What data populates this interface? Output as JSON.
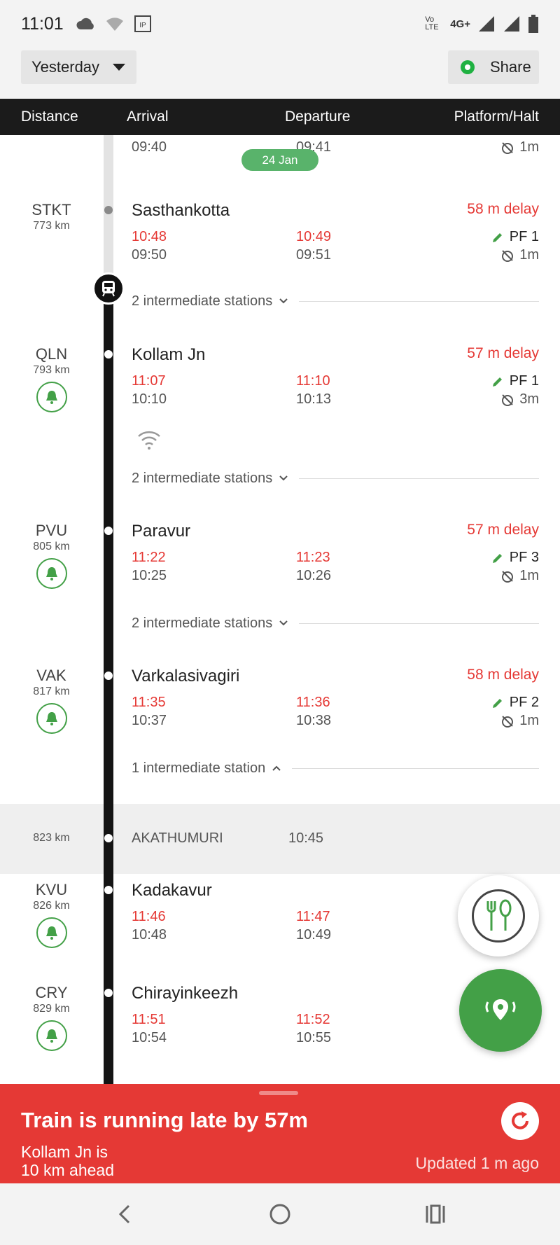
{
  "status_bar": {
    "time": "11:01",
    "network": "4G+",
    "volte": "Vo LTE"
  },
  "top": {
    "day_selector": "Yesterday",
    "share_label": "Share"
  },
  "columns": [
    "Distance",
    "Arrival",
    "Departure",
    "Platform/Halt"
  ],
  "date_pill": "24 Jan",
  "partial_row": {
    "arr_sched": "09:40",
    "dep_sched": "09:41",
    "halt": "1m"
  },
  "stations": [
    {
      "code": "STKT",
      "km": "773 km",
      "name": "Sasthankotta",
      "delay": "58 m delay",
      "arr_actual": "10:48",
      "arr_sched": "09:50",
      "dep_actual": "10:49",
      "dep_sched": "09:51",
      "pf": "PF 1",
      "halt": "1m",
      "alert": false
    },
    {
      "code": "QLN",
      "km": "793 km",
      "name": "Kollam Jn",
      "delay": "57 m delay",
      "arr_actual": "11:07",
      "arr_sched": "10:10",
      "dep_actual": "11:10",
      "dep_sched": "10:13",
      "pf": "PF 1",
      "halt": "3m",
      "alert": true
    },
    {
      "code": "PVU",
      "km": "805 km",
      "name": "Paravur",
      "delay": "57 m delay",
      "arr_actual": "11:22",
      "arr_sched": "10:25",
      "dep_actual": "11:23",
      "dep_sched": "10:26",
      "pf": "PF 3",
      "halt": "1m",
      "alert": true
    },
    {
      "code": "VAK",
      "km": "817 km",
      "name": "Varkalasivagiri",
      "delay": "58 m delay",
      "arr_actual": "11:35",
      "arr_sched": "10:37",
      "dep_actual": "11:36",
      "dep_sched": "10:38",
      "pf": "PF 2",
      "halt": "1m",
      "alert": true
    },
    {
      "code": "KVU",
      "km": "826 km",
      "name": "Kadakavur",
      "arr_actual": "11:46",
      "arr_sched": "10:48",
      "dep_actual": "11:47",
      "dep_sched": "10:49",
      "alert": true
    },
    {
      "code": "CRY",
      "km": "829 km",
      "name": "Chirayinkeezh",
      "arr_actual": "11:51",
      "arr_sched": "10:54",
      "dep_actual": "11:52",
      "dep_sched": "10:55",
      "alert": true
    }
  ],
  "intermediate": [
    "2 intermediate stations",
    "2 intermediate stations",
    "2 intermediate stations",
    "1 intermediate station"
  ],
  "intermediate_stop": {
    "km": "823 km",
    "name": "AKATHUMURI",
    "time": "10:45"
  },
  "banner": {
    "title": "Train is running late by 57m",
    "line1": "Kollam Jn is",
    "line2": "10 km ahead",
    "updated": "Updated 1 m  ago"
  },
  "colors": {
    "delay_red": "#e53935",
    "alert_green": "#43a047",
    "banner_red": "#e53935",
    "header_black": "#1b1b1b"
  }
}
